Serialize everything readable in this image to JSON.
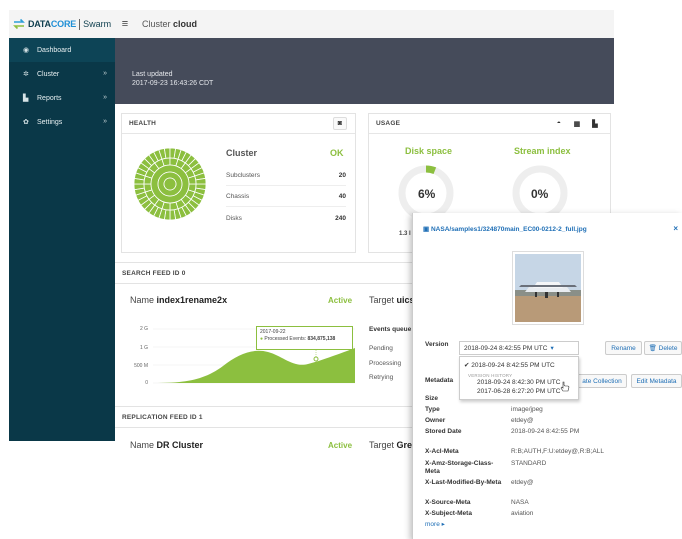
{
  "brand": {
    "name_dark": "DATA",
    "name_accent": "CORE",
    "product": "Swarm"
  },
  "topbar": {
    "menu_icon": "hamburger-icon",
    "prefix": "Cluster",
    "cluster_name": "cloud"
  },
  "sidebar": {
    "items": [
      {
        "label": "Dashboard",
        "icon": "dashboard-icon"
      },
      {
        "label": "Cluster",
        "icon": "cluster-icon"
      },
      {
        "label": "Reports",
        "icon": "chart-icon"
      },
      {
        "label": "Settings",
        "icon": "gear-icon"
      }
    ]
  },
  "header": {
    "last_updated_label": "Last updated",
    "last_updated_value": "2017-09-23  16:43:26 CDT"
  },
  "health": {
    "title": "HEALTH",
    "cluster_label": "Cluster",
    "cluster_status": "OK",
    "rows": [
      {
        "label": "Subclusters",
        "value": "20"
      },
      {
        "label": "Chassis",
        "value": "40"
      },
      {
        "label": "Disks",
        "value": "240"
      }
    ]
  },
  "usage": {
    "title": "USAGE",
    "disk_label": "Disk space",
    "disk_pct": "6%",
    "disk_fraction": 0.06,
    "disk_sub": "1.3 I",
    "stream_label": "Stream index",
    "stream_pct": "0%",
    "stream_fraction": 0.0
  },
  "search_feed": {
    "header": "SEARCH FEED ID 0",
    "name_prefix": "Name",
    "name": "index1rename2x",
    "status": "Active",
    "target_prefix": "Target",
    "target": "uics",
    "y_ticks": [
      "2 G",
      "1 G",
      "500 M",
      "0"
    ],
    "tooltip_date": "2017-09-22",
    "tooltip_label": "Processed Events:",
    "tooltip_value": "834,875,138",
    "events_title": "Events queue",
    "events_rows": [
      "Pending",
      "Processing",
      "Retrying"
    ]
  },
  "replication_feed": {
    "header": "REPLICATION FEED ID 1",
    "name_prefix": "Name",
    "name": "DR Cluster",
    "status": "Active",
    "target_prefix": "Target",
    "target": "Greg"
  },
  "metadata_panel": {
    "title": "NASA/samples1/324870main_EC00-0212-2_full.jpg",
    "version_label": "Version",
    "version_selected": "2018-09-24 8:42:55 PM UTC",
    "rename_label": "Rename",
    "delete_label": "Delete",
    "metadata_label": "Metadata",
    "create_collection_label": "ate Collection",
    "edit_metadata_label": "Edit Metadata",
    "dropdown": {
      "selected": "2018-09-24 8:42:55 PM UTC",
      "history_header": "VERSION HISTORY",
      "history": [
        "2018-09-24 8:42:30 PM UTC",
        "2017-06-28 6:27:20 PM UTC"
      ]
    },
    "fields": [
      {
        "label": "Size",
        "value": ""
      },
      {
        "label": "Type",
        "value": "image/jpeg"
      },
      {
        "label": "Owner",
        "value": "etdey@"
      },
      {
        "label": "Stored Date",
        "value": "2018-09-24 8:42:55 PM"
      },
      {
        "label": "X-Acl-Meta",
        "value": "R:B;AUTH,F:U:etdey@,R:B;ALL"
      },
      {
        "label": "X-Amz-Storage-Class-Meta",
        "value": "STANDARD"
      },
      {
        "label": "X-Last-Modified-By-Meta",
        "value": "etdey@"
      },
      {
        "label": "X-Source-Meta",
        "value": "NASA"
      },
      {
        "label": "X-Subject-Meta",
        "value": "aviation"
      }
    ],
    "more_label": "more ▸"
  }
}
